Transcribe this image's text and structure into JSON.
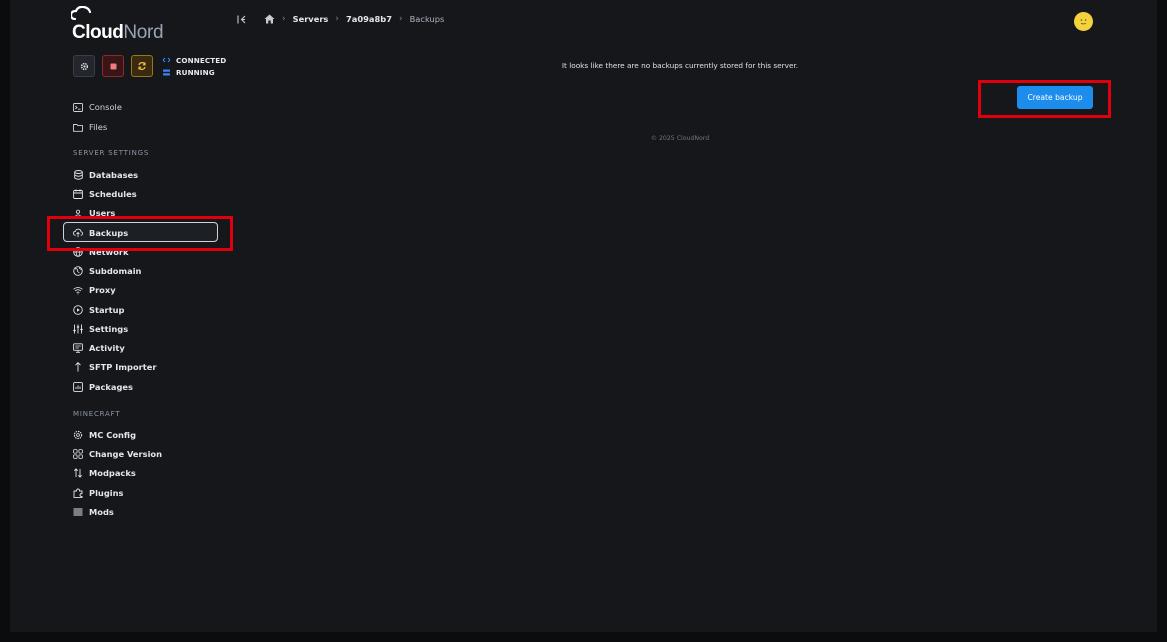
{
  "brand": {
    "part1": "Cloud",
    "part2": "Nord"
  },
  "controls": {
    "status_connection": "CONNECTED",
    "status_power": "RUNNING"
  },
  "breadcrumb": {
    "items": [
      "Servers",
      "7a09a8b7",
      "Backups"
    ]
  },
  "sidebar": {
    "top_items": [
      "Console",
      "Files"
    ],
    "section_server": "SERVER SETTINGS",
    "server_items": [
      "Databases",
      "Schedules",
      "Users",
      "Backups",
      "Network",
      "Subdomain",
      "Proxy",
      "Startup",
      "Settings",
      "Activity",
      "SFTP Importer",
      "Packages"
    ],
    "section_minecraft": "MINECRAFT",
    "minecraft_items": [
      "MC Config",
      "Change Version",
      "Modpacks",
      "Plugins",
      "Mods"
    ]
  },
  "main": {
    "empty_message": "It looks like there are no backups currently stored for this server.",
    "create_button": "Create backup",
    "footer": "© 2025 CloudNord"
  },
  "colors": {
    "accent": "#1c8ded",
    "highlight": "#e0000d",
    "stop": "#8c2a2d",
    "restart": "#9b7619",
    "status_blue": "#3b82f6"
  }
}
